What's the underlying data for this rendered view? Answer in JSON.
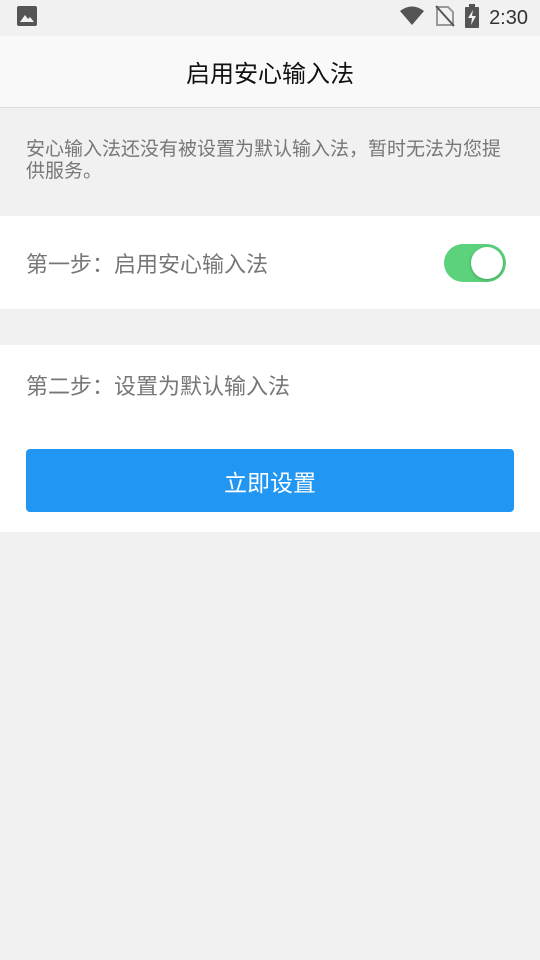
{
  "status_bar": {
    "time": "2:30",
    "icons": [
      "image-icon",
      "wifi-icon",
      "no-sim-icon",
      "battery-charging-icon"
    ]
  },
  "app_bar": {
    "title": "启用安心输入法"
  },
  "notice": {
    "text": "安心输入法还没有被设置为默认输入法，暂时无法为您提供服务。"
  },
  "step1": {
    "label": "第一步：启用安心输入法",
    "toggle_on": true
  },
  "step2": {
    "label": "第二步：设置为默认输入法",
    "button_label": "立即设置"
  },
  "colors": {
    "accent": "#2196f3",
    "toggle_on": "#5bd27b",
    "background": "#f1f1f1"
  }
}
